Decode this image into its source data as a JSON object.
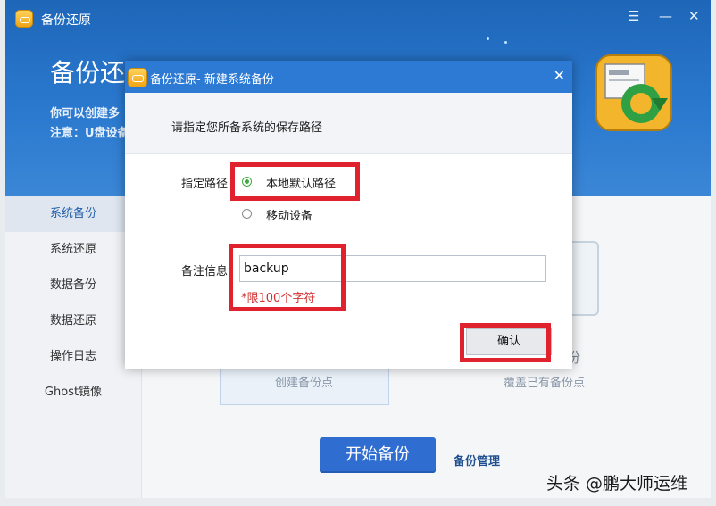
{
  "window": {
    "title": "备份还原",
    "controls": {
      "menu": "☰",
      "minimize": "—",
      "close": "✕"
    }
  },
  "header": {
    "title": "备份还",
    "line1": "你可以创建多",
    "line2": "注意：U盘设备"
  },
  "sidebar": {
    "items": [
      {
        "label": "系统备份",
        "active": true
      },
      {
        "label": "系统还原"
      },
      {
        "label": "数据备份"
      },
      {
        "label": "数据还原"
      },
      {
        "label": "操作日志"
      },
      {
        "label": "Ghost镜像"
      }
    ]
  },
  "main": {
    "card_left_label": "创建备份点",
    "card_right_title": "份",
    "card_right_label": "覆盖已有备份点",
    "start_button": "开始备份",
    "manage_link": "备份管理"
  },
  "dialog": {
    "title": "备份还原- 新建系统备份",
    "close": "✕",
    "prompt": "请指定您所备系统的保存路径",
    "path_label": "指定路径",
    "options": [
      {
        "label": "本地默认路径",
        "checked": true
      },
      {
        "label": "移动设备",
        "checked": false
      }
    ],
    "note_label": "备注信息",
    "note_value": "backup",
    "hint": "*限100个字符",
    "ok_button": "确认"
  },
  "watermark": "头条 @鹏大师运维",
  "colors": {
    "header": "#2a79cf",
    "dialog_titlebar": "#2c7ad4",
    "highlight": "#e0212e",
    "primary_button": "#2f6ed0"
  }
}
